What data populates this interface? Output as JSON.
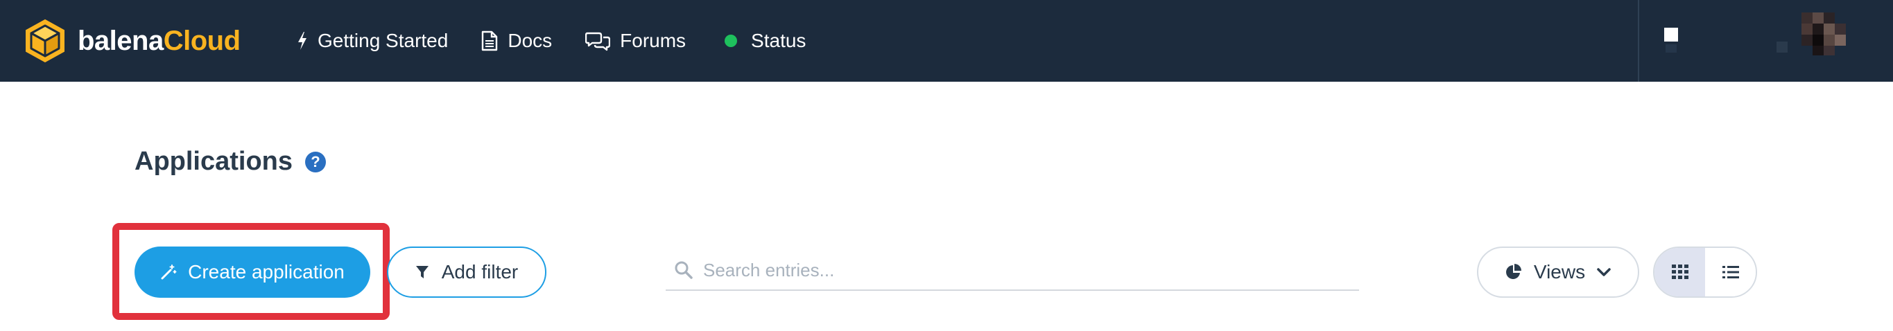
{
  "brand": {
    "name_part1": "balena",
    "name_part2": "Cloud"
  },
  "nav": {
    "items": [
      {
        "label": "Getting Started",
        "icon": "bolt-icon"
      },
      {
        "label": "Docs",
        "icon": "document-icon"
      },
      {
        "label": "Forums",
        "icon": "chat-bubbles-icon"
      },
      {
        "label": "Status",
        "icon": "status-dot-icon"
      }
    ]
  },
  "page": {
    "title": "Applications",
    "help_icon_glyph": "?"
  },
  "toolbar": {
    "create_label": "Create application",
    "add_filter_label": "Add filter",
    "search_placeholder": "Search entries...",
    "views_label": "Views",
    "view_mode": "grid"
  },
  "colors": {
    "topbar_bg": "#1c2b3d",
    "brand_accent": "#f9b320",
    "primary": "#1d9ee4",
    "status_ok": "#1ec15d",
    "highlight": "#e1313c"
  }
}
